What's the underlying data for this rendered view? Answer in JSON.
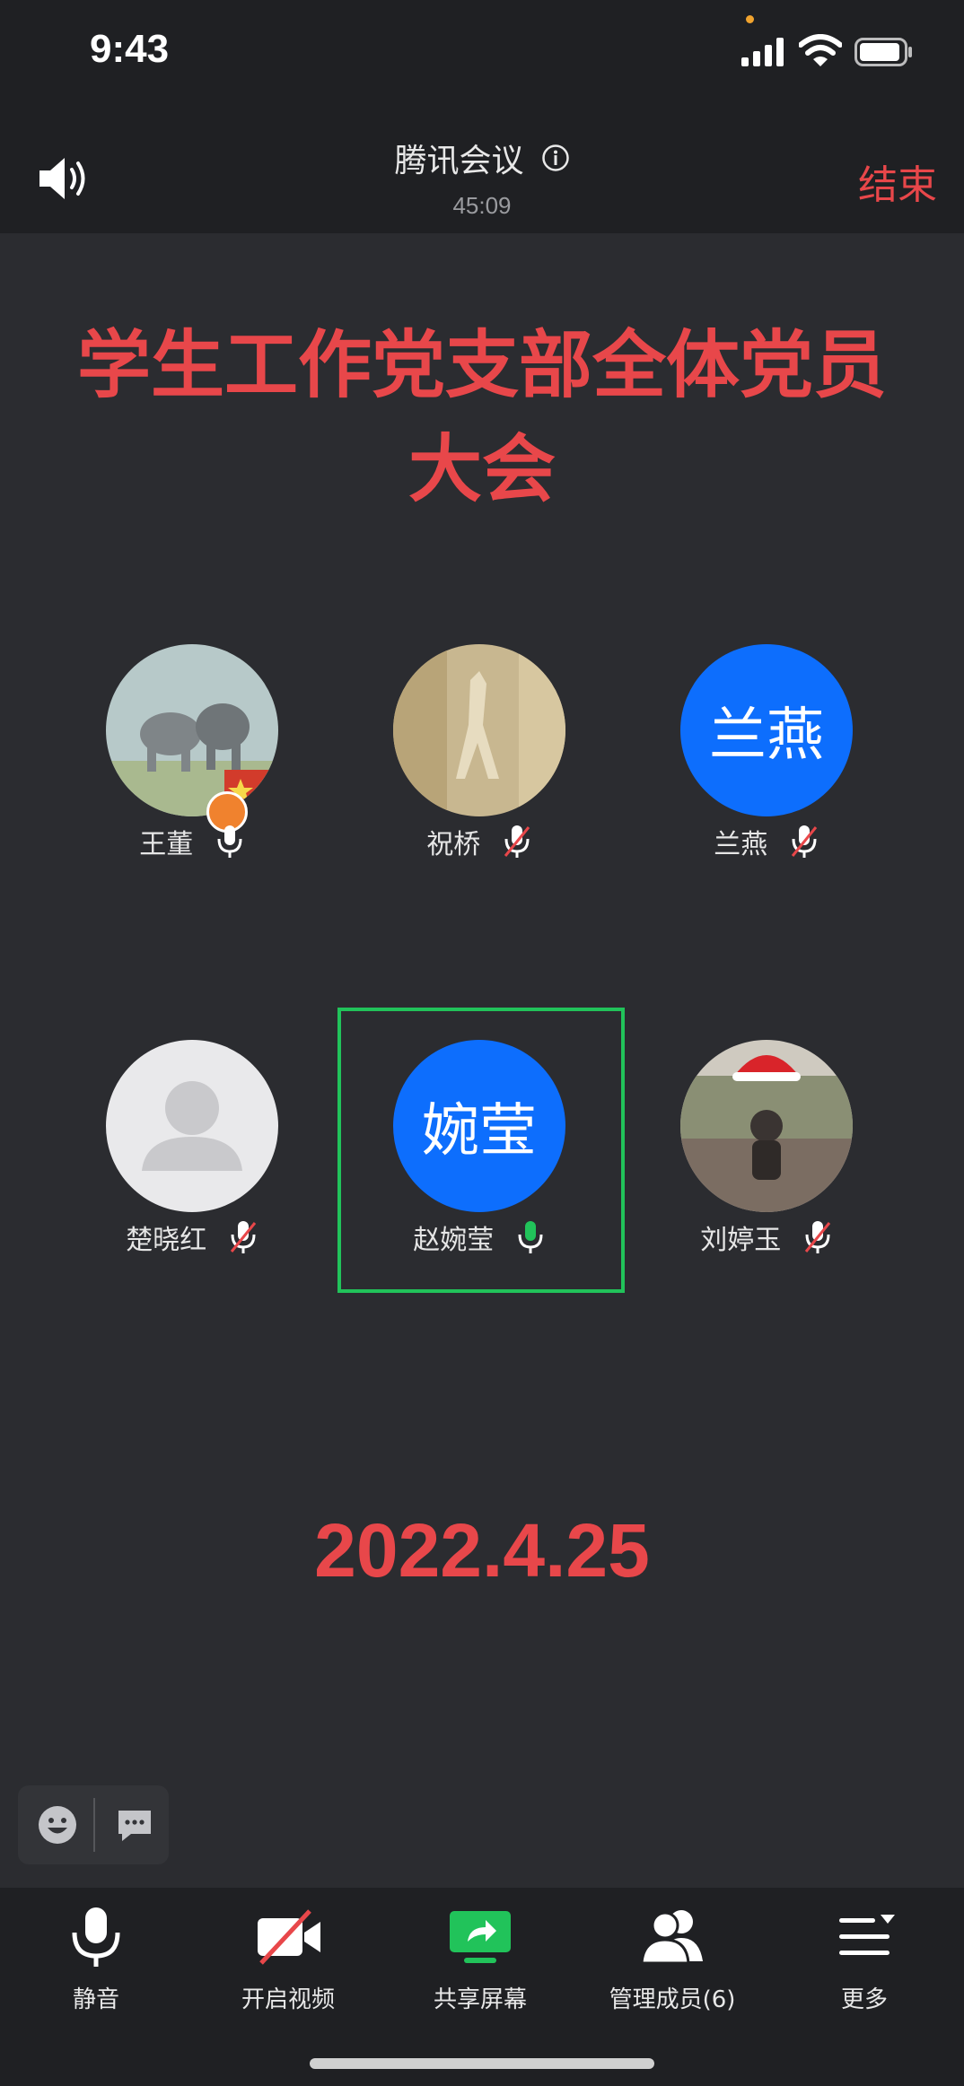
{
  "status_bar": {
    "time": "9:43",
    "icons": [
      "orange-dot-indicator",
      "cellular-signal-icon",
      "wifi-icon",
      "battery-icon"
    ],
    "indicator_color": "#f0a32e"
  },
  "header": {
    "title": "腾讯会议",
    "duration": "45:09",
    "end_label": "结束",
    "speaker_icon": "speaker-icon",
    "info_icon": "info-icon"
  },
  "banner": {
    "line1": "学生工作党支部全体党员",
    "line2": "大会",
    "color": "#e8474a"
  },
  "participants": [
    {
      "name": "王董",
      "avatar": "elephant-photo",
      "mic": "on",
      "host": true
    },
    {
      "name": "祝桥",
      "avatar": "deer-painting-photo",
      "mic": "muted"
    },
    {
      "name": "兰燕",
      "avatar_text": "兰燕",
      "avatar_color": "#0d6efd",
      "mic": "muted"
    },
    {
      "name": "楚晓红",
      "avatar": "default-person-placeholder",
      "mic": "muted"
    },
    {
      "name": "赵婉莹",
      "avatar_text": "婉莹",
      "avatar_color": "#0d6efd",
      "mic": "speaking",
      "active_speaker": true
    },
    {
      "name": "刘婷玉",
      "avatar": "christmas-hat-photo",
      "mic": "muted"
    }
  ],
  "date_text": "2022.4.25",
  "reactions": {
    "emoji_icon": "emoji-icon",
    "chat_icon": "chat-icon"
  },
  "toolbar": {
    "mute_label": "静音",
    "video_label": "开启视频",
    "share_label": "共享屏幕",
    "members_label": "管理成员(6)",
    "more_label": "更多"
  },
  "colors": {
    "background": "#2b2c30",
    "bar": "#1f2023",
    "accent_red": "#e8474a",
    "speaking_green": "#21c35a",
    "avatar_blue": "#0d6efd"
  }
}
